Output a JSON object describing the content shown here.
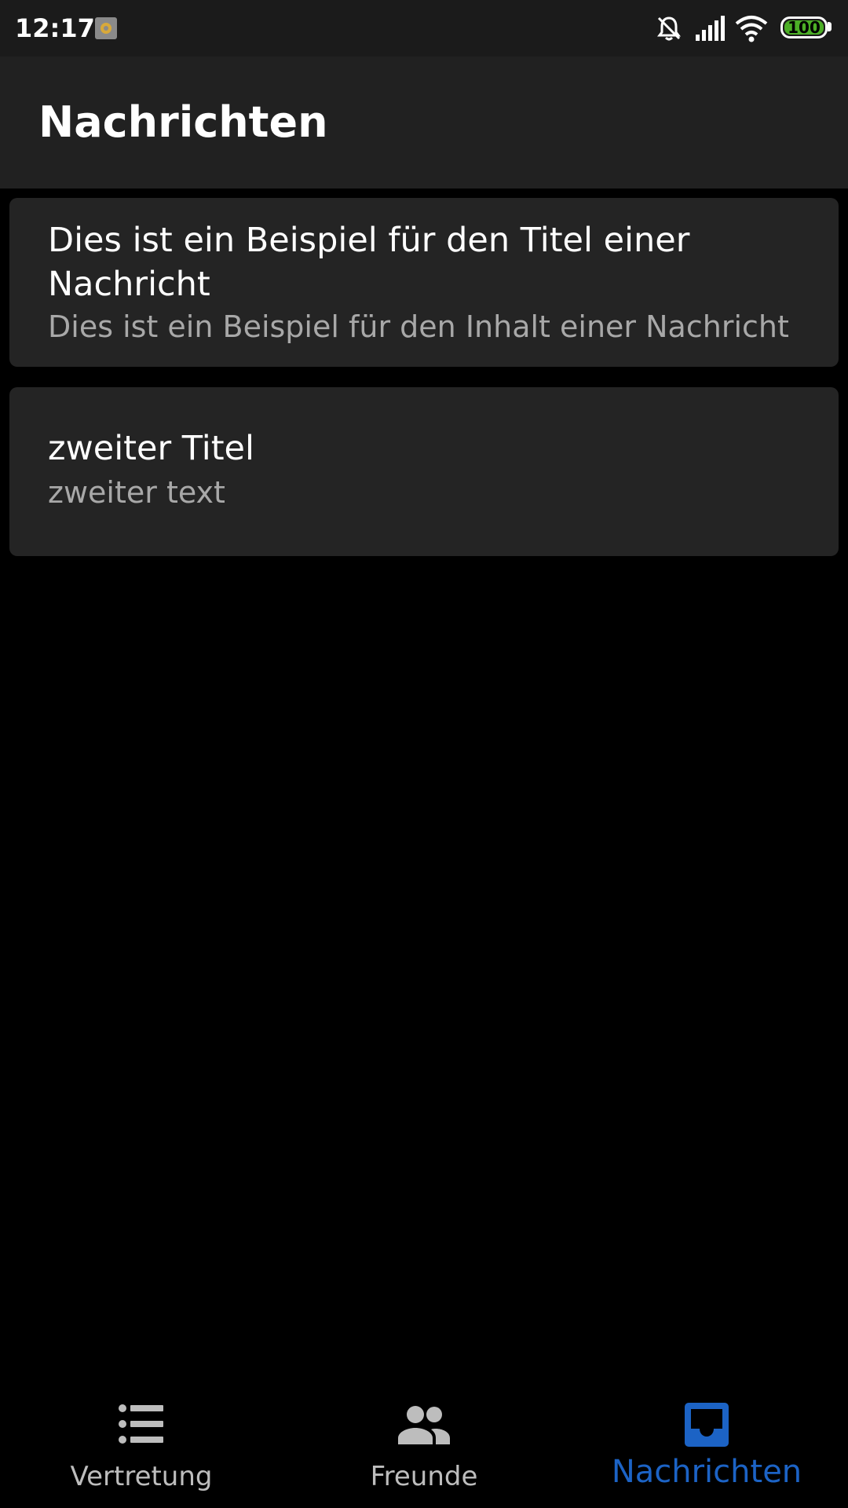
{
  "status_bar": {
    "time": "12:17",
    "battery": "100",
    "icons": [
      "app-notification-icon",
      "silent-bell-icon",
      "signal-icon",
      "wifi-icon",
      "battery-icon"
    ]
  },
  "app_bar": {
    "title": "Nachrichten"
  },
  "messages": [
    {
      "title": "Dies ist ein Beispiel für den Titel einer Nachricht",
      "body": "Dies ist ein Beispiel für den Inhalt einer Nachricht"
    },
    {
      "title": "zweiter Titel",
      "body": "zweiter text"
    }
  ],
  "bottom_nav": {
    "items": [
      {
        "label": "Vertretung",
        "icon": "list-icon",
        "active": false
      },
      {
        "label": "Freunde",
        "icon": "people-icon",
        "active": false
      },
      {
        "label": "Nachrichten",
        "icon": "inbox-icon",
        "active": true
      }
    ]
  },
  "colors": {
    "background": "#000000",
    "surface": "#242424",
    "app_bar": "#212121",
    "accent": "#1c63c5",
    "battery": "#4caf26"
  }
}
